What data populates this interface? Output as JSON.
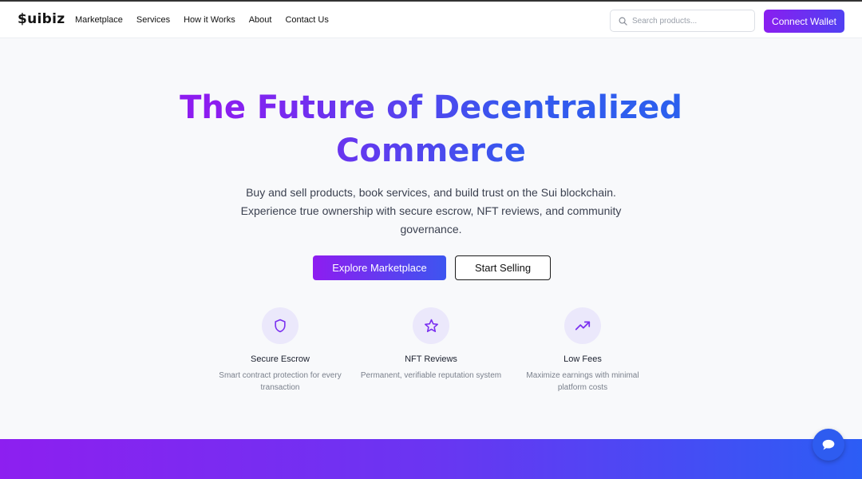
{
  "brand": {
    "logo_text": "$uibiz"
  },
  "nav": {
    "links": [
      "Marketplace",
      "Services",
      "How it Works",
      "About",
      "Contact Us"
    ]
  },
  "search": {
    "placeholder": "Search products..."
  },
  "header": {
    "connect_wallet_label": "Connect Wallet"
  },
  "hero": {
    "title_line1": "The Future of Decentralized",
    "title_line2": "Commerce",
    "subtitle": "Buy and sell products, book services, and build trust on the Sui blockchain. Experience true ownership with secure escrow, NFT reviews, and community governance.",
    "primary_button": "Explore Marketplace",
    "secondary_button": "Start Selling"
  },
  "features": [
    {
      "icon": "shield-icon",
      "title": "Secure Escrow",
      "description": "Smart contract protection for every transaction"
    },
    {
      "icon": "star-icon",
      "title": "NFT Reviews",
      "description": "Permanent, verifiable reputation system"
    },
    {
      "icon": "trending-up-icon",
      "title": "Low Fees",
      "description": "Maximize earnings with minimal platform costs"
    }
  ],
  "colors": {
    "accent_purple": "#8a1ef0",
    "accent_blue": "#2c5df5",
    "icon_bg": "#ebe8fb"
  },
  "chat": {
    "icon": "chat-bubble-icon"
  }
}
